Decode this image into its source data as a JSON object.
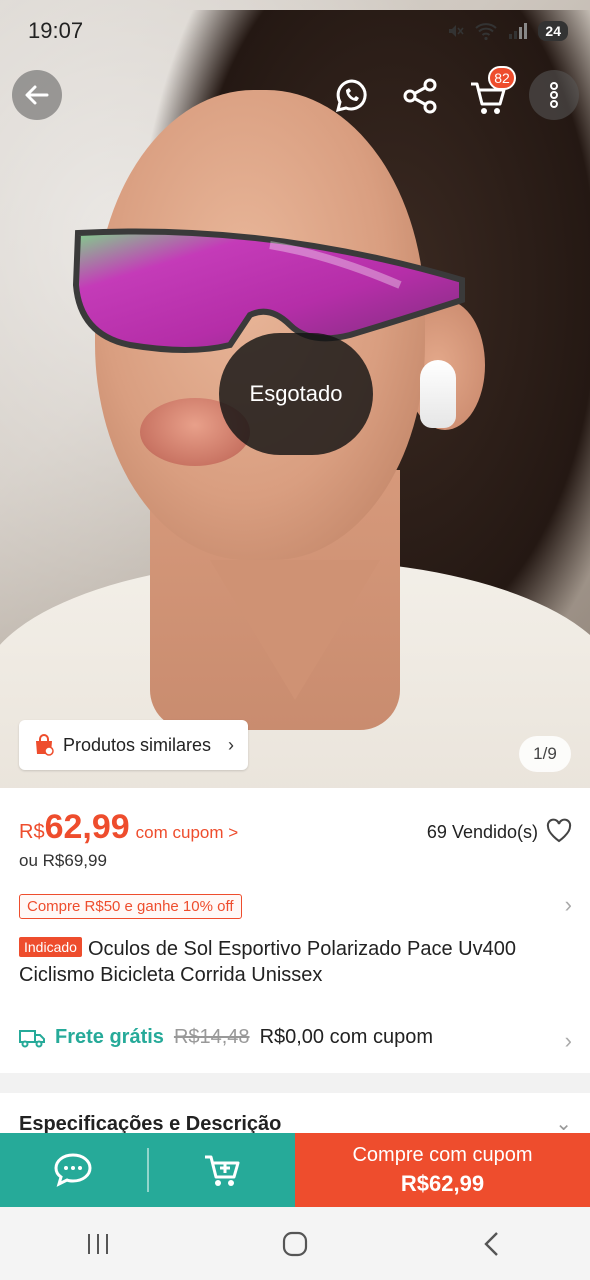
{
  "status_bar": {
    "time": "19:07",
    "battery": "24"
  },
  "top_bar": {
    "cart_count": "82"
  },
  "image": {
    "sold_out_label": "Esgotado",
    "similar_label": "Produtos similares",
    "pager": "1/9"
  },
  "product": {
    "currency": "R$",
    "price": "62,99",
    "coupon_link": "com cupom >",
    "sold": "69 Vendido(s)",
    "original_price": "ou R$69,99",
    "promo": "Compre R$50 e ganhe 10% off",
    "tag": "Indicado",
    "title": "Oculos de Sol Esportivo Polarizado Pace Uv400 Ciclismo Bicicleta Corrida Unissex"
  },
  "shipping": {
    "free_label": "Frete grátis",
    "old_price": "R$14,48",
    "new_price": "R$0,00 com cupom"
  },
  "specs": {
    "label": "Especificações e Descrição"
  },
  "action_bar": {
    "buy_line1": "Compre com cupom",
    "buy_line2": "R$62,99"
  },
  "colors": {
    "brand": "#ee4d2d",
    "teal": "#26aa99"
  }
}
